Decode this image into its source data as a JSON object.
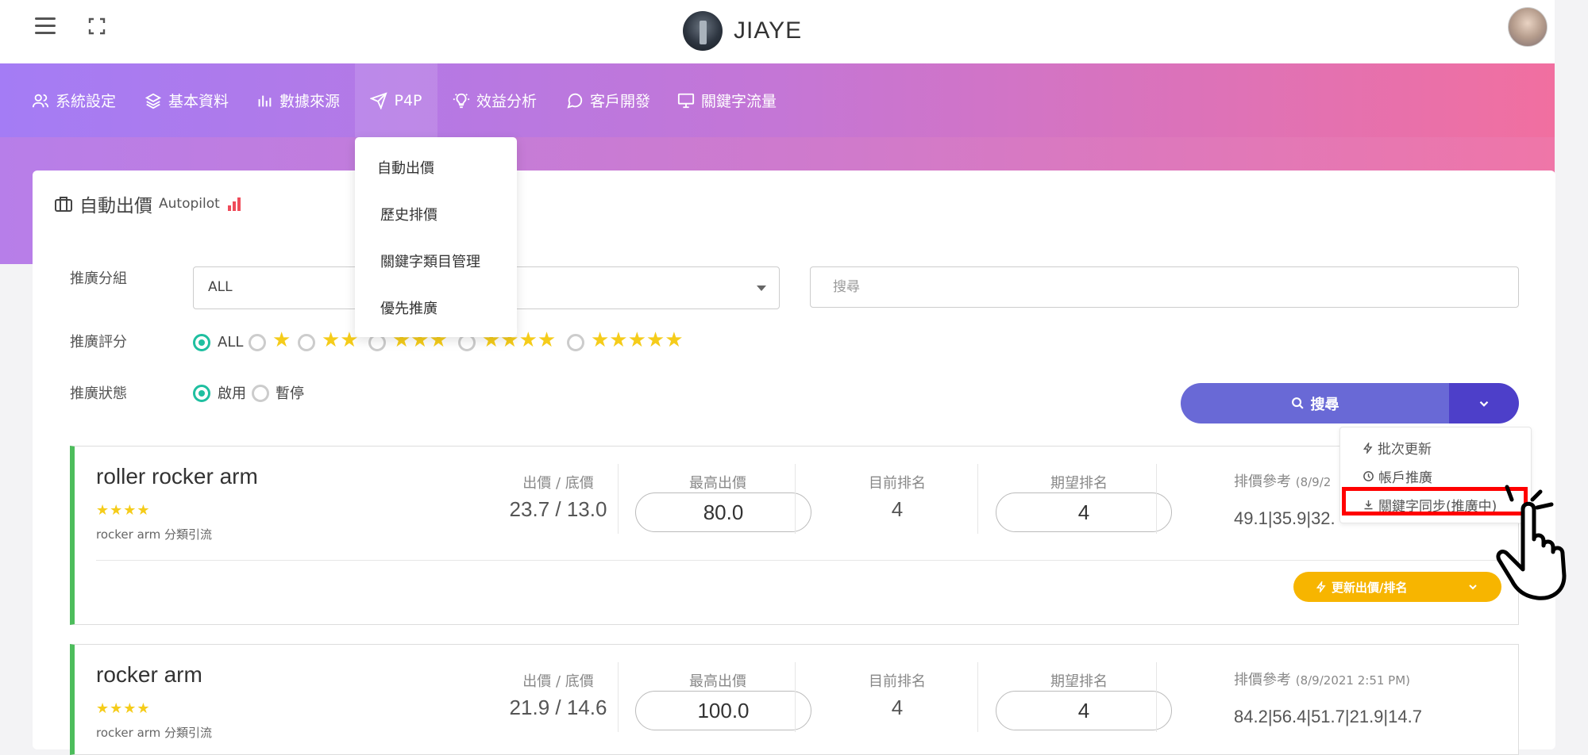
{
  "brand": {
    "name": "JIAYE"
  },
  "nav": [
    {
      "label": "系統設定",
      "icon": "users-icon"
    },
    {
      "label": "基本資料",
      "icon": "layers-icon"
    },
    {
      "label": "數據來源",
      "icon": "bar-chart-icon"
    },
    {
      "label": "P4P",
      "icon": "send-icon"
    },
    {
      "label": "效益分析",
      "icon": "bulb-icon"
    },
    {
      "label": "客戶開發",
      "icon": "chat-icon"
    },
    {
      "label": "關鍵字流量",
      "icon": "monitor-icon"
    }
  ],
  "p4p_menu": [
    "自動出價",
    "歷史排價",
    "關鍵字類目管理",
    "優先推廣"
  ],
  "page": {
    "title": "自動出價",
    "subtitle": "Autopilot"
  },
  "filters": {
    "group_label": "推廣分組",
    "group_value": "ALL",
    "search_placeholder": "搜尋",
    "rating_label": "推廣評分",
    "rating_all": "ALL",
    "status_label": "推廣狀態",
    "status_on": "啟用",
    "status_off": "暫停"
  },
  "search_button": {
    "label": "搜尋"
  },
  "split_menu": [
    "批次更新",
    "帳戶推廣",
    "關鍵字同步(推廣中)"
  ],
  "keywords": [
    {
      "name": "roller rocker arm",
      "stars": "★★★★",
      "category": "rocker arm 分類引流",
      "bid_label": "出價 / 底價",
      "bid_value": "23.7 / 13.0",
      "max_label": "最高出價",
      "max_value": "80.0",
      "rank_label": "目前排名",
      "rank_value": "4",
      "target_label": "期望排名",
      "target_value": "4",
      "ref_label": "排價參考",
      "ref_time": "(8/9/2",
      "ref_values": "49.1|35.9|32.",
      "update_button": "更新出價/排名"
    },
    {
      "name": "rocker arm",
      "stars": "★★★★",
      "category": "rocker arm 分類引流",
      "bid_label": "出價 / 底價",
      "bid_value": "21.9 / 14.6",
      "max_label": "最高出價",
      "max_value": "100.0",
      "rank_label": "目前排名",
      "rank_value": "4",
      "target_label": "期望排名",
      "target_value": "4",
      "ref_label": "排價參考",
      "ref_time": "(8/9/2021 2:51 PM)",
      "ref_values": "84.2|56.4|51.7|21.9|14.7"
    }
  ],
  "colors": {
    "accent": "#6969d6",
    "success": "#4dbd5c",
    "warning": "#f7b500",
    "radio": "#1fbfa0",
    "star": "#f5cc1a",
    "highlight": "#ff0000"
  }
}
